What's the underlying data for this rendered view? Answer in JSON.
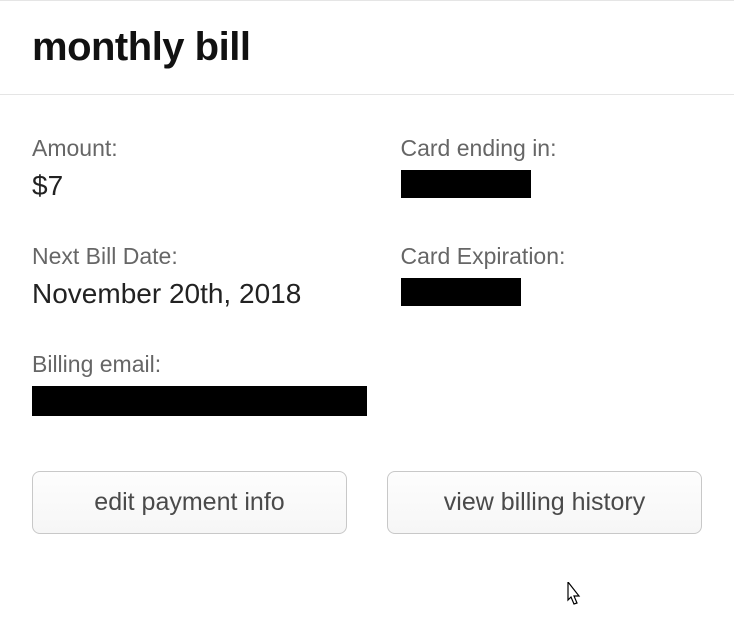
{
  "header": {
    "title": "monthly bill"
  },
  "fields": {
    "amount": {
      "label": "Amount:",
      "value": "$7"
    },
    "card_ending": {
      "label": "Card ending in:",
      "value": ""
    },
    "next_bill": {
      "label": "Next Bill Date:",
      "value": "November 20th, 2018"
    },
    "card_expiration": {
      "label": "Card Expiration:",
      "value": ""
    },
    "billing_email": {
      "label": "Billing email:",
      "value": ""
    }
  },
  "actions": {
    "edit_payment": "edit payment info",
    "view_history": "view billing history"
  }
}
